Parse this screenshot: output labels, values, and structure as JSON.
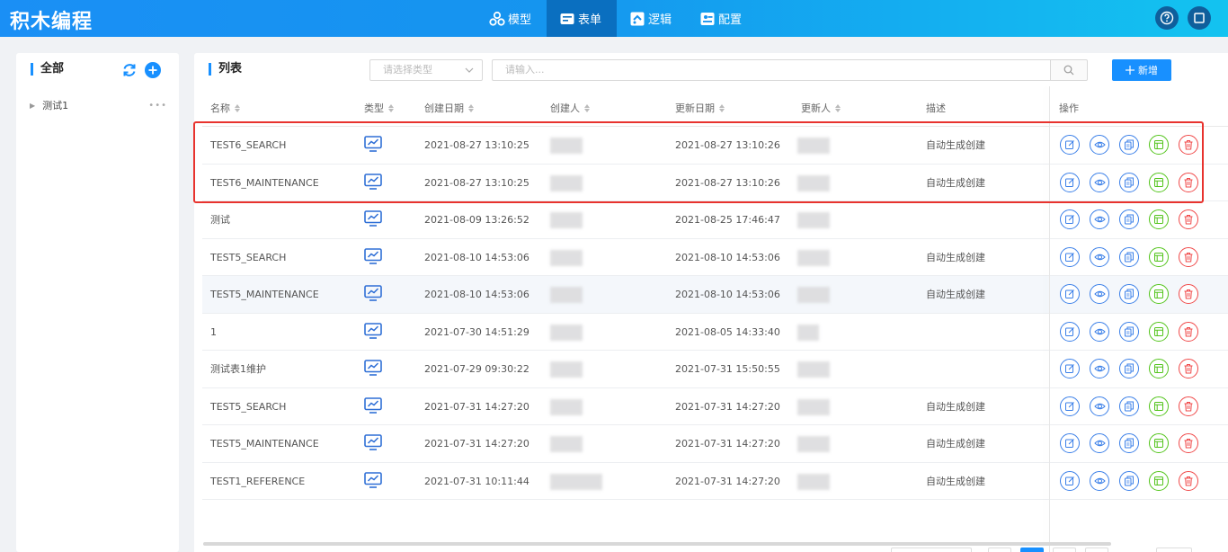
{
  "app": {
    "title": "积木编程"
  },
  "nav": [
    {
      "label": "模型",
      "icon": "model-icon"
    },
    {
      "label": "表单",
      "icon": "form-icon",
      "active": true
    },
    {
      "label": "逻辑",
      "icon": "logic-icon"
    },
    {
      "label": "配置",
      "icon": "config-icon"
    }
  ],
  "sidebar": {
    "title": "全部",
    "items": [
      {
        "label": "测试1"
      }
    ]
  },
  "list": {
    "title": "列表",
    "type_select_placeholder": "请选择类型",
    "search_placeholder": "请输入...",
    "add_label": "新增"
  },
  "table": {
    "columns": {
      "name": "名称",
      "type": "类型",
      "created_at": "创建日期",
      "creator": "创建人",
      "updated_at": "更新日期",
      "updater": "更新人",
      "desc": "描述",
      "actions": "操作"
    },
    "rows": [
      {
        "name": "TEST6_SEARCH",
        "created_at": "2021-08-27 13:10:25",
        "updated_at": "2021-08-27 13:10:26",
        "desc": "自动生成创建"
      },
      {
        "name": "TEST6_MAINTENANCE",
        "created_at": "2021-08-27 13:10:25",
        "updated_at": "2021-08-27 13:10:26",
        "desc": "自动生成创建"
      },
      {
        "name": "测试",
        "created_at": "2021-08-09 13:26:52",
        "updated_at": "2021-08-25 17:46:47",
        "desc": ""
      },
      {
        "name": "TEST5_SEARCH",
        "created_at": "2021-08-10 14:53:06",
        "updated_at": "2021-08-10 14:53:06",
        "desc": "自动生成创建"
      },
      {
        "name": "TEST5_MAINTENANCE",
        "created_at": "2021-08-10 14:53:06",
        "updated_at": "2021-08-10 14:53:06",
        "desc": "自动生成创建"
      },
      {
        "name": "1",
        "created_at": "2021-07-30 14:51:29",
        "updated_at": "2021-08-05 14:33:40",
        "desc": ""
      },
      {
        "name": "测试表1维护",
        "created_at": "2021-07-29 09:30:22",
        "updated_at": "2021-07-31 15:50:55",
        "desc": ""
      },
      {
        "name": "TEST5_SEARCH",
        "created_at": "2021-07-31 14:27:20",
        "updated_at": "2021-07-31 14:27:20",
        "desc": "自动生成创建"
      },
      {
        "name": "TEST5_MAINTENANCE",
        "created_at": "2021-07-31 14:27:20",
        "updated_at": "2021-07-31 14:27:20",
        "desc": "自动生成创建"
      },
      {
        "name": "TEST1_REFERENCE",
        "created_at": "2021-07-31 10:11:44",
        "updated_at": "2021-07-31 14:27:20",
        "desc": "自动生成创建"
      }
    ]
  },
  "icons": {
    "type": "monitor-chart-icon",
    "actions": [
      "edit-icon",
      "view-icon",
      "copy-icon",
      "design-icon",
      "delete-icon"
    ]
  },
  "colors": {
    "primary": "#1890ff",
    "highlight_border": "#e8332e",
    "success": "#52c41a",
    "danger": "#f04848"
  }
}
